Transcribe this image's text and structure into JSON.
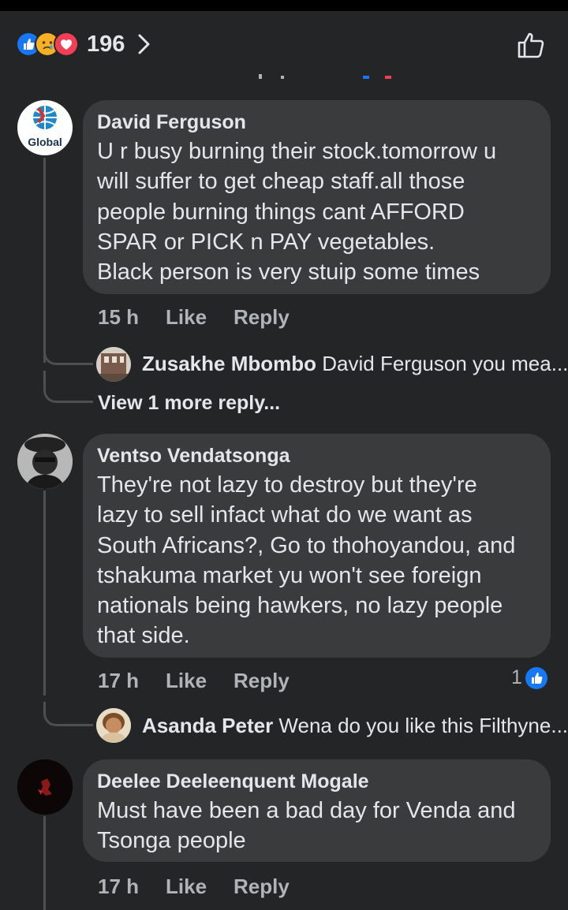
{
  "header": {
    "reaction_icons": [
      "like-icon",
      "sad-icon",
      "love-icon"
    ],
    "reaction_count": "196"
  },
  "colors": {
    "background": "#242526",
    "bubble": "#3a3b3c",
    "text": "#e4e6eb",
    "secondary_text": "#b0b3b8",
    "like_blue": "#1877f2",
    "love_red": "#f33e58",
    "sad_yellow": "#f7b125"
  },
  "comments": [
    {
      "author": "David Ferguson",
      "avatar_text": "Global",
      "lines": [
        "U r busy burning their stock.tomorrow u",
        "will suffer to get cheap staff.all those",
        "people burning things cant AFFORD",
        "SPAR or PICK n PAY vegetables.",
        "Black person is very stuip some times"
      ],
      "time": "15 h",
      "like_label": "Like",
      "reply_label": "Reply",
      "reply_preview": {
        "name": "Zusakhe Mbombo",
        "text": "David Ferguson you mea..."
      },
      "view_more": "View 1 more reply..."
    },
    {
      "author": "Ventso Vendatsonga",
      "lines": [
        "They're not lazy to destroy  but they're",
        "lazy to sell infact what do we want as",
        "South Africans?, Go to thohoyandou, and",
        "tshakuma market yu won't see foreign",
        "nationals being hawkers, no lazy people",
        "that side."
      ],
      "time": "17 h",
      "like_label": "Like",
      "reply_label": "Reply",
      "reaction_count": "1",
      "reply_preview": {
        "name": "Asanda Peter",
        "text": "Wena do you like this Filthyne..."
      }
    },
    {
      "author": "Deelee Deeleenquent Mogale",
      "lines": [
        "Must have been a bad day for Venda and",
        "Tsonga people"
      ],
      "time": "17 h",
      "like_label": "Like",
      "reply_label": "Reply"
    }
  ]
}
